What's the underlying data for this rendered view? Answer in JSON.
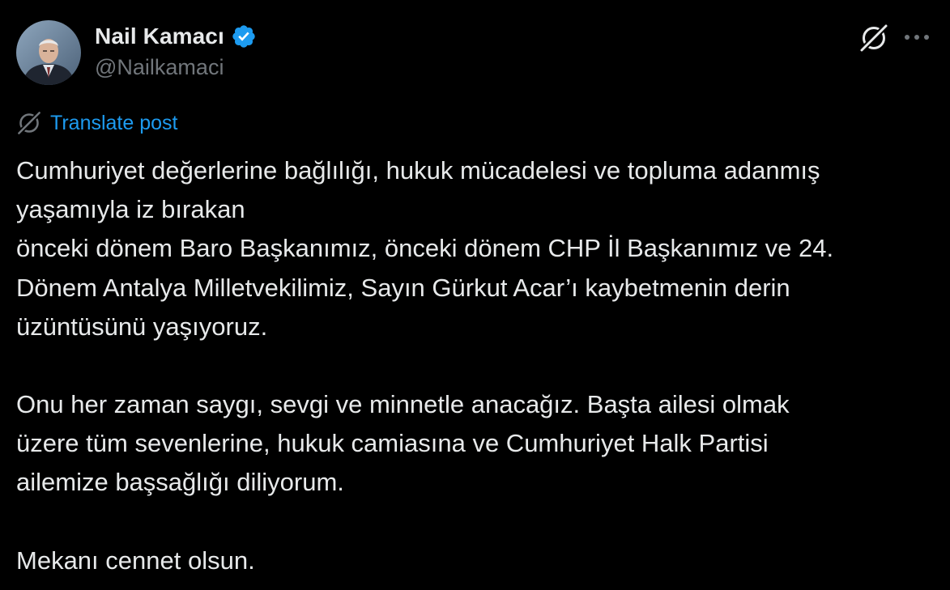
{
  "author": {
    "display_name": "Nail Kamacı",
    "handle": "@Nailkamaci",
    "verified": true
  },
  "actions": {
    "grok_icon": "grok-icon",
    "more_icon": "more-horizontal-icon"
  },
  "translate": {
    "label": "Translate post",
    "icon": "grok-icon"
  },
  "post": {
    "lines_p1": [
      "Cumhuriyet değerlerine bağlılığı, hukuk mücadelesi ve topluma adanmış",
      "yaşamıyla iz bırakan",
      "önceki dönem Baro Başkanımız, önceki dönem CHP İl Başkanımız ve 24.",
      "Dönem Antalya Milletvekilimiz, Sayın Gürkut Acar’ı kaybetmenin derin",
      "üzüntüsünü yaşıyoruz."
    ],
    "lines_p2": [
      "Onu her zaman saygı, sevgi ve minnetle anacağız. Başta ailesi olmak",
      "üzere tüm sevenlerine, hukuk camiasına ve Cumhuriyet Halk Partisi",
      "ailemize başsağlığı diliyorum."
    ],
    "line_p3": "Mekanı cennet olsun."
  },
  "colors": {
    "background": "#000000",
    "text": "#e7e9ea",
    "secondary": "#71767b",
    "link": "#1d9bf0",
    "verified": "#1d9bf0"
  }
}
